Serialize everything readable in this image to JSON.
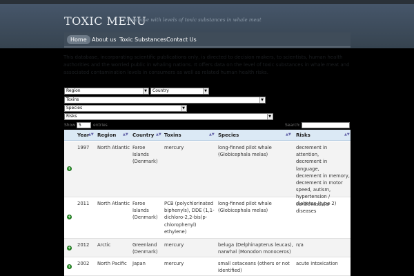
{
  "site": {
    "title": "TOXIC MENU",
    "description": "Database with levels of toxic substances in whale meat"
  },
  "nav": {
    "items": [
      {
        "label": "Home",
        "active": true
      },
      {
        "label": "About us",
        "active": false
      },
      {
        "label": "Toxic Substances",
        "active": false
      },
      {
        "label": "Contact Us",
        "active": false
      }
    ]
  },
  "intro": "This database, incorporating scientific publications only, is directed to decision makers, to scientists, human health authorities and the worried public in whaling nations. It offers data on the level of toxic substances in whale meat and associated contamination levels in consumers as well as related human health risks.",
  "filters": {
    "region": "Region",
    "country": "Country",
    "toxins": "Toxins",
    "species": "Species",
    "risks": "Risks"
  },
  "table_controls": {
    "show_label": "Show",
    "entries_value": "5",
    "entries_label": "entries",
    "search_label": "Search:"
  },
  "table": {
    "headers": [
      "Year",
      "Region",
      "Country",
      "Toxins",
      "Species",
      "Risks"
    ],
    "rows": [
      {
        "year": "1997",
        "region": "North Atlantic",
        "country": [
          "Faroe",
          "Islands",
          "(Denmark)"
        ],
        "toxins": [
          "mercury"
        ],
        "species": [
          "long-finned pilot whale",
          "(Globicephala melas)"
        ],
        "risks": [
          "decrement in attention,",
          "decrement in language,",
          "decrement in memory,",
          "decrement in motor",
          "speed, autism,",
          "hypertension /",
          "cardiovascular diseases"
        ]
      },
      {
        "year": "2011",
        "region": "North Atlantic",
        "country": [
          "Faroe",
          "Islands",
          "(Denmark)"
        ],
        "toxins": [
          "PCB (polychlorinated",
          "biphenyls), DDE (1,1-",
          "dichloro-2,2-bis(p-",
          "chlorophenyl)",
          "ethylene)"
        ],
        "species": [
          "long-finned pilot whale",
          "(Globicephala melas)"
        ],
        "risks": [
          "diabetes (type 2)"
        ]
      },
      {
        "year": "2012",
        "region": "Arctic",
        "country": [
          "Greenland",
          "(Denmark)"
        ],
        "toxins": [
          "mercury"
        ],
        "species": [
          "beluga (Delphinapterus leucas),",
          "narwhal (Monodon monoceros)"
        ],
        "risks": [
          "n/a"
        ]
      },
      {
        "year": "2002",
        "region": "North Pacific",
        "country": [
          "Japan"
        ],
        "toxins": [
          "mercury"
        ],
        "species": [
          "small cetaceans (others or not",
          "identified)"
        ],
        "risks": [
          "acute intoxication"
        ]
      }
    ]
  }
}
